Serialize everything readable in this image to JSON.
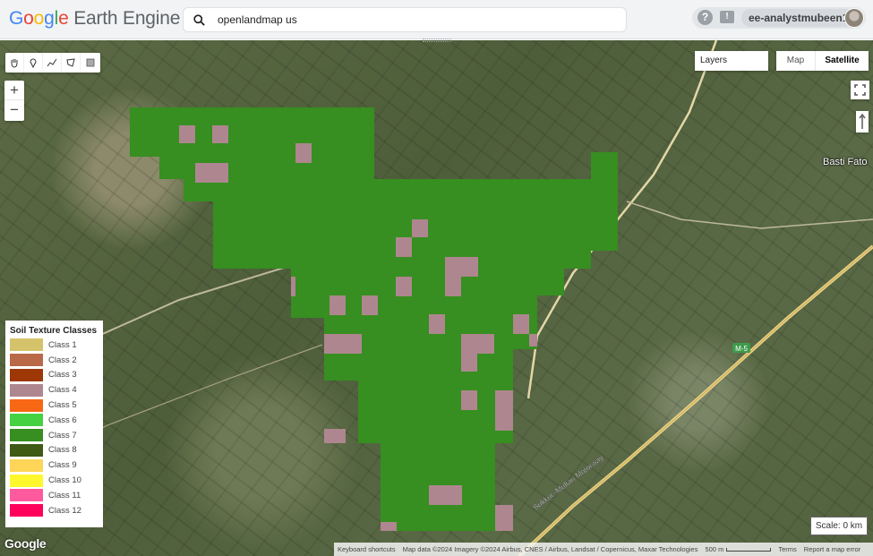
{
  "header": {
    "logo_google": "Google",
    "logo_rest": "Earth Engine",
    "search_value": "openlandmap us",
    "help_icon": "help-icon",
    "feedback_icon": "feedback-icon",
    "username": "ee-analystmubeen12"
  },
  "map": {
    "layers_label": "Layers",
    "maptype_map": "Map",
    "maptype_satellite": "Satellite",
    "zoom_in": "+",
    "zoom_out": "−",
    "place_label": "Basti Fato",
    "road_label_1": "M-5",
    "road_label_2": "Sukkur–Multan Motorway",
    "scale_label": "Scale: 0 km",
    "google_logo": "Google"
  },
  "tools": [
    "hand-tool-icon",
    "point-marker-icon",
    "line-tool-icon",
    "polygon-tool-icon",
    "rectangle-tool-icon"
  ],
  "legend": {
    "title": "Soil Texture Classes",
    "items": [
      {
        "label": "Class 1",
        "color": "#d5c36b"
      },
      {
        "label": "Class 2",
        "color": "#b96947"
      },
      {
        "label": "Class 3",
        "color": "#9d3706"
      },
      {
        "label": "Class 4",
        "color": "#ae868f"
      },
      {
        "label": "Class 5",
        "color": "#f86714"
      },
      {
        "label": "Class 6",
        "color": "#46d143"
      },
      {
        "label": "Class 7",
        "color": "#368f20"
      },
      {
        "label": "Class 8",
        "color": "#3e5a14"
      },
      {
        "label": "Class 9",
        "color": "#ffd557"
      },
      {
        "label": "Class 10",
        "color": "#fff72e"
      },
      {
        "label": "Class 11",
        "color": "#ff5a9d"
      },
      {
        "label": "Class 12",
        "color": "#ff005b"
      }
    ]
  },
  "footer": {
    "shortcuts": "Keyboard shortcuts",
    "attribution": "Map data ©2024 Imagery ©2024 Airbus, CNES / Airbus, Landsat / Copernicus, Maxar Technologies",
    "scale": "500 m",
    "terms": "Terms",
    "report": "Report a map error"
  }
}
